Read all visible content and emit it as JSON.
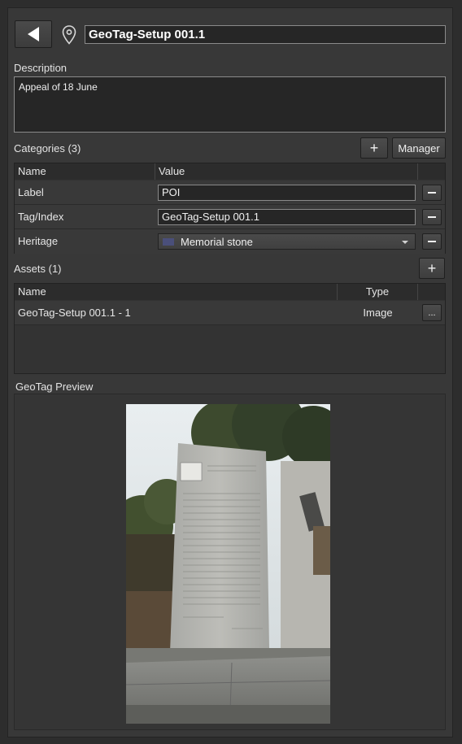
{
  "header": {
    "title": "GeoTag-Setup  001.1"
  },
  "description": {
    "label": "Description",
    "text": "Appeal of 18 June"
  },
  "categories": {
    "label": "Categories (3)",
    "add_symbol": "+",
    "manager_label": "Manager",
    "columns": [
      "Name",
      "Value"
    ],
    "rows": [
      {
        "name": "Label",
        "value": "POI"
      },
      {
        "name": "Tag/Index",
        "value": "GeoTag-Setup  001.1"
      },
      {
        "name": "Heritage",
        "value": "Memorial stone",
        "swatch_color": "#4a4f7a"
      }
    ]
  },
  "assets": {
    "label": "Assets (1)",
    "add_symbol": "+",
    "columns": [
      "Name",
      "Type"
    ],
    "rows": [
      {
        "name": "GeoTag-Setup  001.1 - 1",
        "type": "Image",
        "action": "..."
      }
    ]
  },
  "preview": {
    "label": "GeoTag Preview"
  },
  "colors": {
    "background": "#2d2d2d",
    "panel": "#383838",
    "field": "#262626",
    "accent_swatch": "#4a4f7a"
  }
}
